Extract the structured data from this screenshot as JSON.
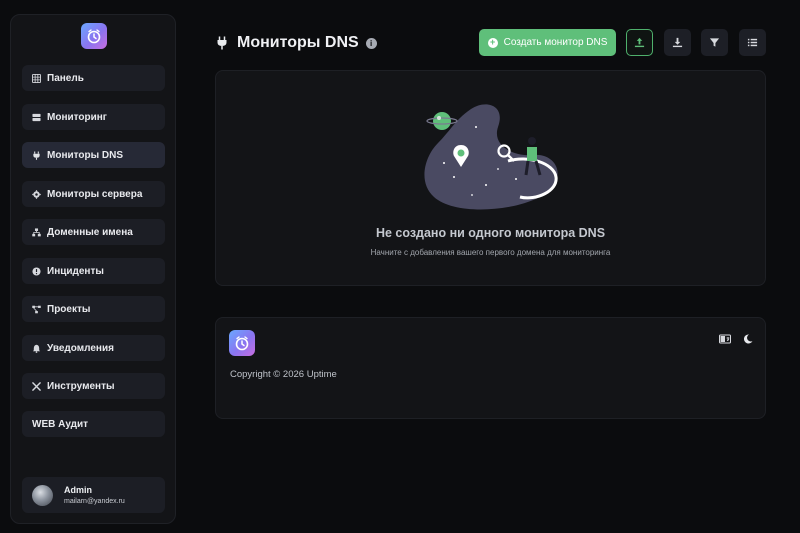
{
  "app": {
    "logo_icon": "clock-logo-icon",
    "accent_color": "#5fbf7a"
  },
  "sidebar": {
    "items": [
      {
        "label": "Панель",
        "icon": "grid-icon"
      },
      {
        "label": "Мониторинг",
        "icon": "server-icon"
      },
      {
        "label": "Мониторы DNS",
        "icon": "plug-icon",
        "active": true
      },
      {
        "label": "Мониторы сервера",
        "icon": "gear-icon"
      },
      {
        "label": "Доменные имена",
        "icon": "sitemap-icon"
      },
      {
        "label": "Инциденты",
        "icon": "alert-icon"
      },
      {
        "label": "Проекты",
        "icon": "project-diagram-icon"
      },
      {
        "label": "Уведомления",
        "icon": "bell-icon"
      },
      {
        "label": "Инструменты",
        "icon": "tools-icon"
      },
      {
        "label": "WEB Аудит",
        "icon": ""
      }
    ],
    "user": {
      "name": "Admin",
      "email": "mailarn@yandex.ru"
    }
  },
  "header": {
    "title": "Мониторы DNS",
    "create_button": "Создать монитор DNS",
    "tools": [
      "upload-icon",
      "download-icon",
      "filter-icon",
      "list-icon"
    ]
  },
  "empty_state": {
    "title": "Не создано ни одного монитора DNS",
    "subtitle": "Начните с добавления вашего первого домена для мониторинга"
  },
  "footer": {
    "copyright": "Copyright © 2026 Uptime",
    "icons": [
      "language-icon",
      "moon-icon"
    ]
  }
}
